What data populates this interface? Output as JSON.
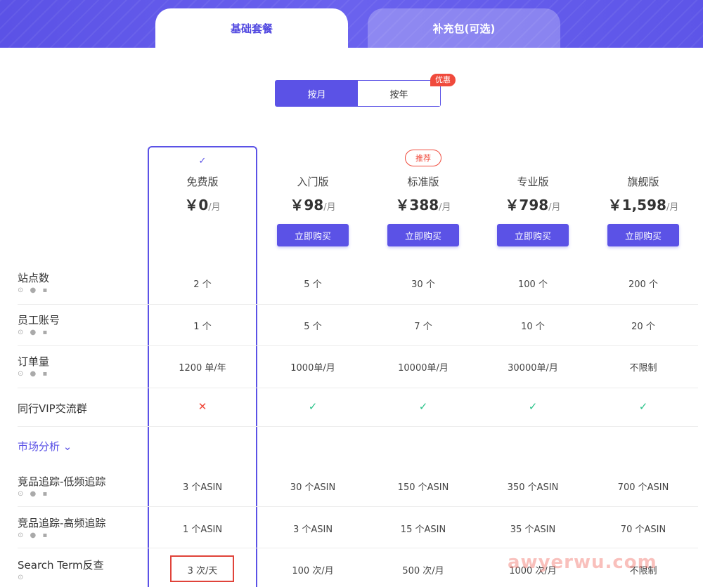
{
  "tabs": {
    "basic": "基础套餐",
    "addon": "补充包(可选)"
  },
  "billing": {
    "monthly": "按月",
    "yearly": "按年",
    "badge": "优惠"
  },
  "plans": [
    {
      "name": "免费版",
      "currency": "￥",
      "price": "0",
      "unit": "/月",
      "selected": true,
      "check": "✓",
      "buy": ""
    },
    {
      "name": "入门版",
      "currency": "￥",
      "price": "98",
      "unit": "/月",
      "buy": "立即购买"
    },
    {
      "name": "标准版",
      "currency": "￥",
      "price": "388",
      "unit": "/月",
      "buy": "立即购买",
      "badge": "推荐"
    },
    {
      "name": "专业版",
      "currency": "￥",
      "price": "798",
      "unit": "/月",
      "buy": "立即购买"
    },
    {
      "name": "旗舰版",
      "currency": "￥",
      "price": "1,598",
      "unit": "/月",
      "buy": "立即购买"
    }
  ],
  "rows": [
    {
      "label": "站点数",
      "icons": "⊙ ● ▪",
      "values": [
        "2 个",
        "5 个",
        "30 个",
        "100 个",
        "200 个"
      ]
    },
    {
      "label": "员工账号",
      "icons": "⊙ ● ▪",
      "values": [
        "1 个",
        "5 个",
        "7 个",
        "10 个",
        "20 个"
      ]
    },
    {
      "label": "订单量",
      "icons": "⊙ ● ▪",
      "values": [
        "1200 单/年",
        "1000单/月",
        "10000单/月",
        "30000单/月",
        "不限制"
      ]
    },
    {
      "label": "同行VIP交流群",
      "values": [
        "✕",
        "✓",
        "✓",
        "✓",
        "✓"
      ]
    },
    {
      "label": "竞品追踪-低频追踪",
      "icons": "⊙ ● ▪",
      "values": [
        "3 个ASIN",
        "30 个ASIN",
        "150 个ASIN",
        "350 个ASIN",
        "700 个ASIN"
      ]
    },
    {
      "label": "竞品追踪-高频追踪",
      "icons": "⊙ ● ▪",
      "values": [
        "1 个ASIN",
        "3 个ASIN",
        "15 个ASIN",
        "35 个ASIN",
        "70 个ASIN"
      ]
    },
    {
      "label": "Search Term反查",
      "icons": "⊙",
      "values": [
        "3 次/天",
        "100 次/月",
        "500 次/月",
        "1000 次/月",
        "不限制"
      ]
    }
  ],
  "section": {
    "market": "市场分析 ⌄"
  },
  "watermark": "awyerwu.com",
  "colors": {
    "accent": "#5b52e6",
    "danger": "#f04a3c",
    "success": "#2cc38a"
  }
}
